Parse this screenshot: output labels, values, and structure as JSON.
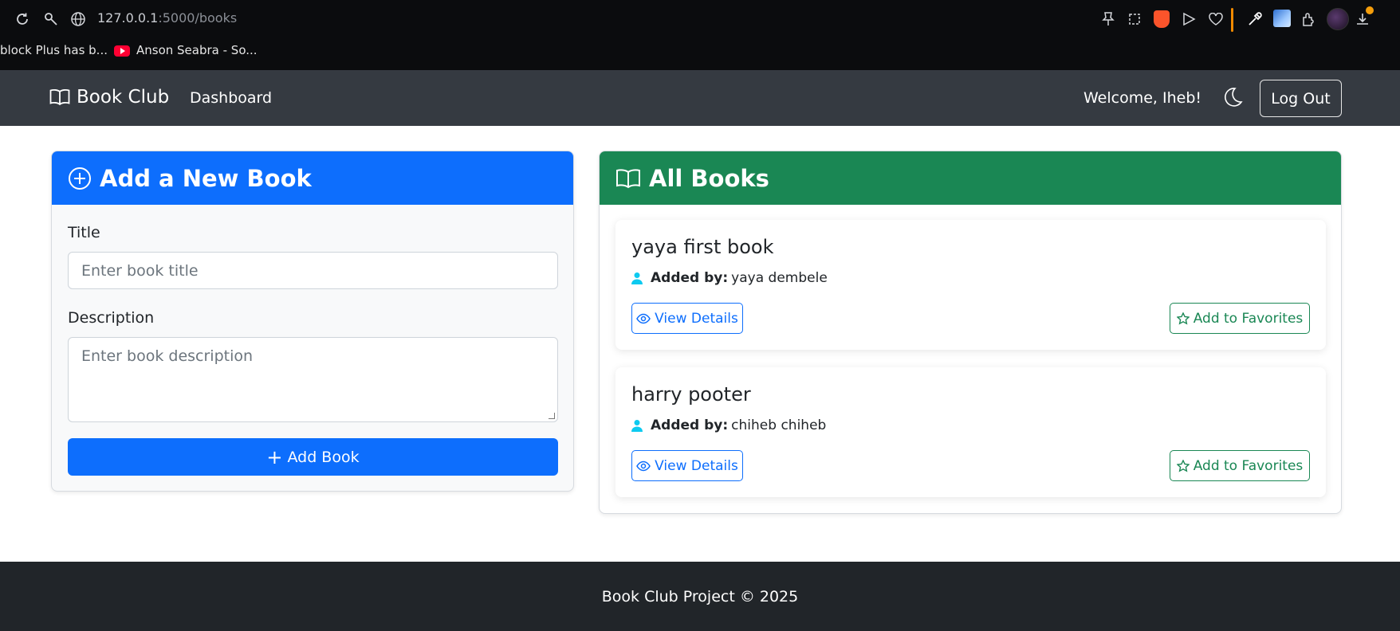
{
  "browser": {
    "url_host": "127.0.0.1",
    "url_path": ":5000/books",
    "bookmarks": [
      {
        "label": "block Plus has b..."
      },
      {
        "label": "Anson Seabra - So..."
      }
    ]
  },
  "navbar": {
    "brand": "Book Club",
    "links": [
      {
        "label": "Dashboard"
      }
    ],
    "welcome": "Welcome, Iheb!",
    "logout_label": "Log Out"
  },
  "add_book": {
    "heading": "Add a New Book",
    "title_label": "Title",
    "title_placeholder": "Enter book title",
    "description_label": "Description",
    "description_placeholder": "Enter book description",
    "submit_label": "Add Book"
  },
  "all_books": {
    "heading": "All Books",
    "added_by_label": "Added by:",
    "view_label": "View Details",
    "favorite_label": "Add to Favorites",
    "items": [
      {
        "title": "yaya first book",
        "added_by": "yaya dembele"
      },
      {
        "title": "harry pooter",
        "added_by": "chiheb chiheb"
      }
    ]
  },
  "footer": {
    "text": "Book Club Project © 2025"
  },
  "colors": {
    "primary": "#0d6efd",
    "success": "#1a8754",
    "navbar": "#353a41",
    "footer": "#212529",
    "user_icon": "#0dcaf0"
  },
  "icons": [
    "reload-icon",
    "site-info-icon",
    "globe-icon",
    "pin-icon",
    "screenshot-icon",
    "brave-shield-icon",
    "send-icon",
    "heart-icon",
    "eyedropper-icon",
    "extensions-icon",
    "download-icon",
    "book-icon",
    "moon-icon",
    "plus-circle-icon",
    "user-icon",
    "eye-icon",
    "star-icon"
  ]
}
